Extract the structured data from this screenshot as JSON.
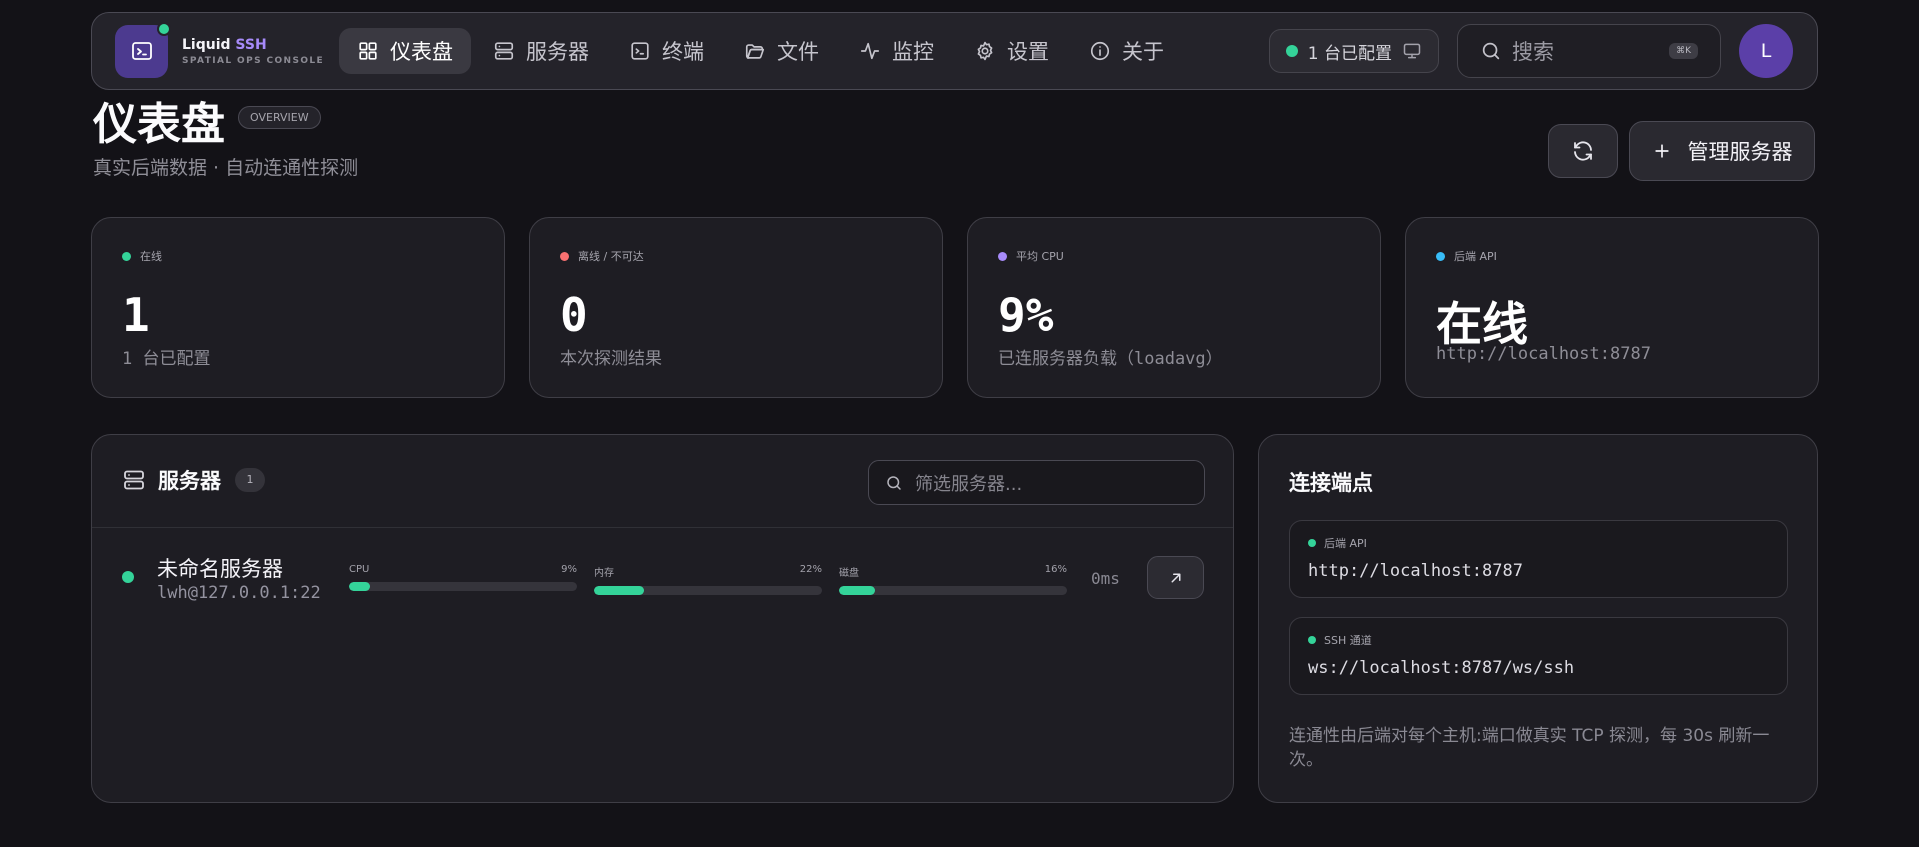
{
  "app": {
    "name": "Liquid",
    "name_accent": "SSH",
    "subtitle": "SPATIAL OPS CONSOLE"
  },
  "nav": {
    "tabs": [
      {
        "label": "仪表盘",
        "icon": "grid-icon",
        "active": true
      },
      {
        "label": "服务器",
        "icon": "server-icon",
        "active": false
      },
      {
        "label": "终端",
        "icon": "terminal-icon",
        "active": false
      },
      {
        "label": "文件",
        "icon": "folder-icon",
        "active": false
      },
      {
        "label": "监控",
        "icon": "activity-icon",
        "active": false
      },
      {
        "label": "设置",
        "icon": "gear-icon",
        "active": false
      },
      {
        "label": "关于",
        "icon": "info-icon",
        "active": false
      }
    ],
    "config_status": "1 台已配置",
    "search_placeholder": "搜索",
    "search_shortcut": "⌘K",
    "avatar_initial": "L"
  },
  "header": {
    "title": "仪表盘",
    "badge": "OVERVIEW",
    "subtitle": "真实后端数据 · 自动连通性探测",
    "manage_button": "管理服务器"
  },
  "stats": [
    {
      "label": "在线",
      "value": "1",
      "desc": "1 台已配置",
      "color": "#34d399"
    },
    {
      "label": "离线 / 不可达",
      "value": "0",
      "desc": "本次探测结果",
      "color": "#f87171"
    },
    {
      "label": "平均 CPU",
      "value": "9%",
      "desc": "已连服务器负载（loadavg）",
      "color": "#a78bfa"
    },
    {
      "label": "后端 API",
      "value": "在线",
      "desc": "http://localhost:8787",
      "color": "#38bdf8"
    }
  ],
  "servers": {
    "title": "服务器",
    "count": "1",
    "filter_placeholder": "筛选服务器...",
    "rows": [
      {
        "name": "未命名服务器",
        "host": "lwh@127.0.0.1:22",
        "status_color": "#34d399",
        "metrics": [
          {
            "label": "CPU",
            "value": "9%",
            "percent": 9
          },
          {
            "label": "内存",
            "value": "22%",
            "percent": 22
          },
          {
            "label": "磁盘",
            "value": "16%",
            "percent": 16
          }
        ],
        "latency": "0ms"
      }
    ]
  },
  "endpoints": {
    "title": "连接端点",
    "items": [
      {
        "label": "后端 API",
        "value": "http://localhost:8787"
      },
      {
        "label": "SSH 通道",
        "value": "ws://localhost:8787/ws/ssh"
      }
    ],
    "note": "连通性由后端对每个主机:端口做真实 TCP 探测，每 30s 刷新一次。"
  }
}
